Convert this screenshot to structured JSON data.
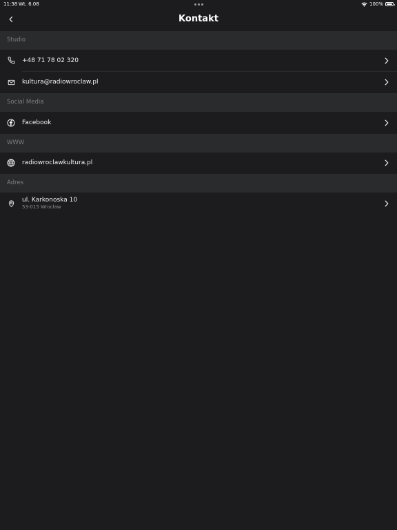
{
  "status_bar": {
    "time": "11:38",
    "date": "Wt. 6.08",
    "battery": "100%"
  },
  "nav": {
    "title": "Kontakt"
  },
  "sections": {
    "studio": {
      "header": "Studio",
      "phone": "+48 71 78 02 320",
      "email": "kultura@radiowroclaw.pl"
    },
    "social": {
      "header": "Social Media",
      "facebook": "Facebook"
    },
    "www": {
      "header": "WWW",
      "website": "radiowroclawkultura.pl"
    },
    "address": {
      "header": "Adres",
      "street": "ul. Karkonoska 10",
      "city": "53-015 Wrocław"
    }
  },
  "icons": {
    "back": "chevron-left-icon",
    "phone": "phone-icon",
    "email": "mail-icon",
    "facebook": "facebook-icon",
    "website": "globe-icon",
    "address": "map-pin-icon",
    "row_disclosure": "chevron-right-icon"
  },
  "colors": {
    "background": "#1c1c1e",
    "section_header_bg": "#2a2b2d",
    "section_header_text": "#7d7f83",
    "text": "#f2f2f2",
    "secondary_text": "#8b8d92"
  }
}
